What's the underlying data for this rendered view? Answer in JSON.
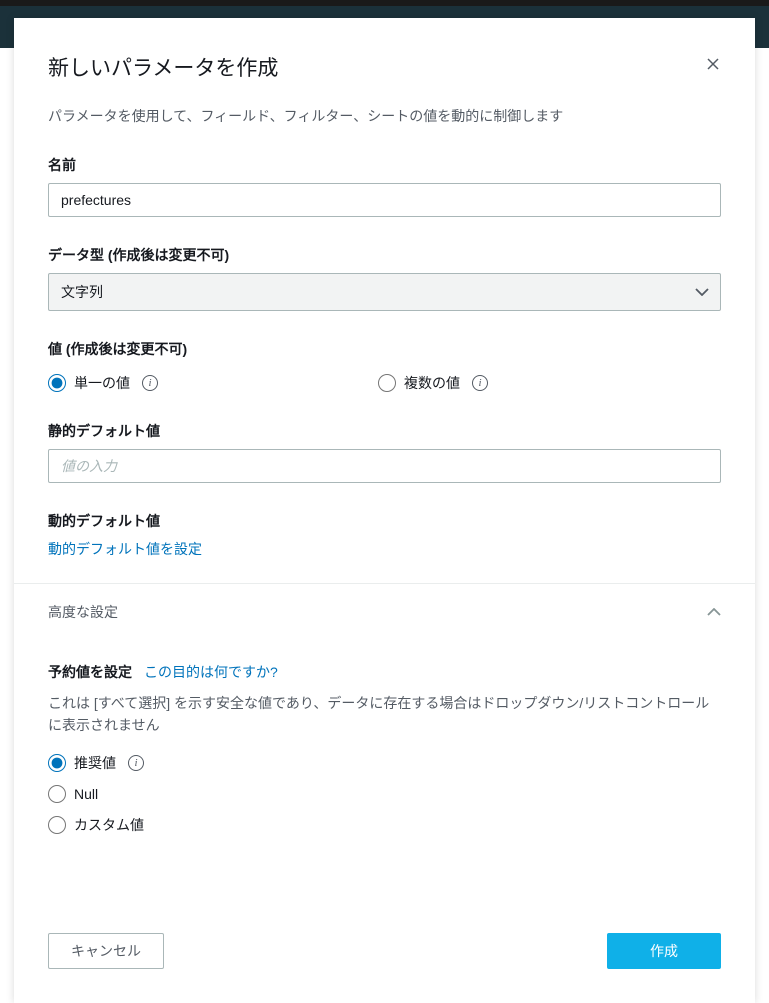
{
  "modal": {
    "title": "新しいパラメータを作成",
    "description": "パラメータを使用して、フィールド、フィルター、シートの値を動的に制御します"
  },
  "name": {
    "label": "名前",
    "value": "prefectures"
  },
  "dataType": {
    "label": "データ型 (作成後は変更不可)",
    "selected": "文字列"
  },
  "values": {
    "label": "値 (作成後は変更不可)",
    "single": "単一の値",
    "multiple": "複数の値"
  },
  "staticDefault": {
    "label": "静的デフォルト値",
    "placeholder": "値の入力"
  },
  "dynamicDefault": {
    "label": "動的デフォルト値",
    "link": "動的デフォルト値を設定"
  },
  "advanced": {
    "title": "高度な設定"
  },
  "reserve": {
    "title": "予約値を設定",
    "helpLink": "この目的は何ですか?",
    "description": "これは [すべて選択] を示す安全な値であり、データに存在する場合はドロップダウン/リストコントロールに表示されません",
    "recommended": "推奨値",
    "null": "Null",
    "custom": "カスタム値"
  },
  "footer": {
    "cancel": "キャンセル",
    "create": "作成"
  }
}
